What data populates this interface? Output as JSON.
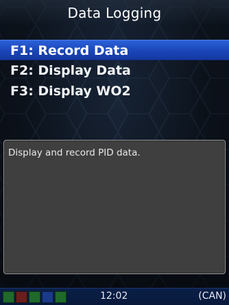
{
  "header": {
    "title": "Data Logging"
  },
  "menu": {
    "items": [
      {
        "label": "F1: Record Data",
        "selected": true
      },
      {
        "label": "F2: Display Data",
        "selected": false
      },
      {
        "label": "F3: Display WO2",
        "selected": false
      }
    ]
  },
  "description": {
    "text": "Display and record PID data."
  },
  "status_bar": {
    "indicators": [
      {
        "name": "indicator-1",
        "color": "#1f6a2a"
      },
      {
        "name": "indicator-2",
        "color": "#6a1e1e"
      },
      {
        "name": "indicator-3",
        "color": "#1f6a2a"
      },
      {
        "name": "indicator-4",
        "color": "#1a3a8a"
      },
      {
        "name": "indicator-5",
        "color": "#1f6a2a"
      }
    ],
    "time": "12:02",
    "protocol": "(CAN)"
  },
  "colors": {
    "selection": "#1f4fc6",
    "panel": "#3f3f3f",
    "status_bar": "#0a1f47"
  }
}
